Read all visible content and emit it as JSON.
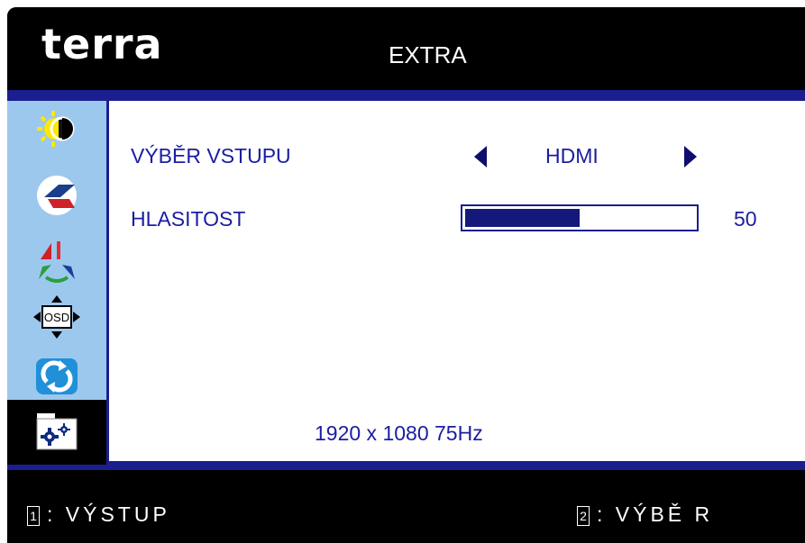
{
  "header": {
    "logo": "terra",
    "title": "EXTRA"
  },
  "sidebar": {
    "items": [
      {
        "icon": "brightness-contrast-icon"
      },
      {
        "icon": "image-position-icon"
      },
      {
        "icon": "color-icon"
      },
      {
        "icon": "osd-settings-icon"
      },
      {
        "icon": "reset-icon"
      },
      {
        "icon": "extra-settings-icon",
        "selected": true
      }
    ],
    "osd_icon_text": "OSD"
  },
  "main": {
    "input_select": {
      "label": "VÝBĚR VSTUPU",
      "value": "HDMI"
    },
    "volume": {
      "label": "HLASITOST",
      "value": "50",
      "level_percent": 50
    },
    "resolution": "1920 x 1080 75Hz"
  },
  "footer": {
    "left_key": "1",
    "left_label": ": VÝSTUP",
    "right_key": "2",
    "right_label": ": VÝBĚ R"
  },
  "colors": {
    "accent": "#1b1ea0",
    "frame": "#1b1e8e",
    "sidebar": "#9dc8ee"
  }
}
